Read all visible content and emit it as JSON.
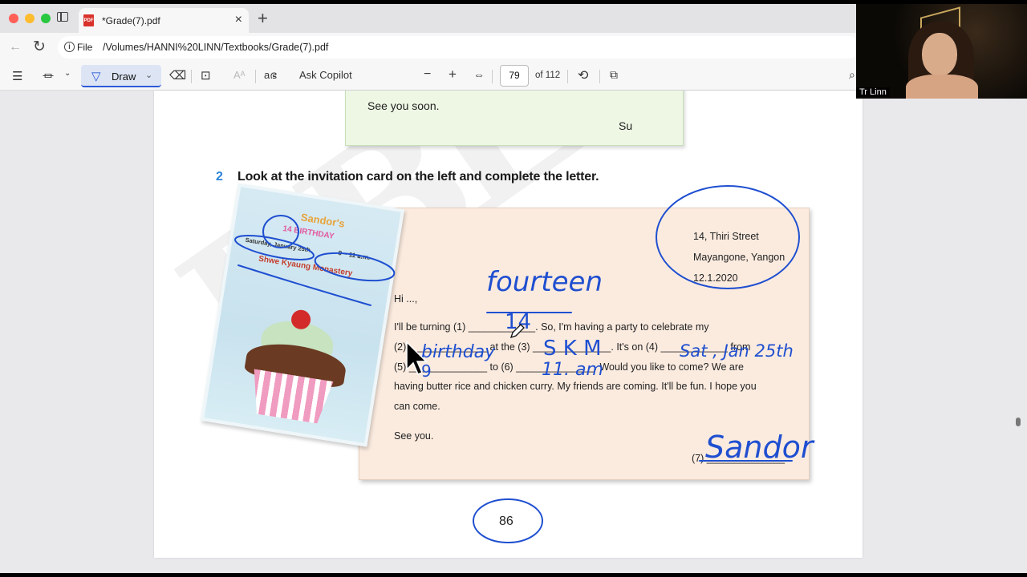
{
  "browser": {
    "tab_title": "*Grade(7).pdf",
    "tab_pdf_badge": "PDF",
    "url_scheme": "File",
    "url_path": "/Volumes/HANNI%20LINN/Textbooks/Grade(7).pdf"
  },
  "pdf_toolbar": {
    "draw_label": "Draw",
    "copilot_label": "Ask Copilot",
    "zoom_out": "−",
    "zoom_in": "+",
    "page_current": "79",
    "page_total": "of 112"
  },
  "document": {
    "prev_letter_closing": "See you soon.",
    "prev_letter_signature": "Su",
    "question_number": "2",
    "question_text": "Look at the invitation card on the left and complete the letter.",
    "card": {
      "name": "Sandor's",
      "birthday": "14 BIRTHDAY",
      "date": "Saturday, January 25th",
      "time": "9 – 11 a.m.",
      "venue": "Shwe Kyaung Monastery"
    },
    "letter": {
      "address_line1": "14, Thiri Street",
      "address_line2": "Mayangone, Yangon",
      "date": "12.1.2020",
      "greeting": "Hi ...,",
      "line1": "I'll  be  turning  (1) ____________.  So,  I'm  having  a  party  to  celebrate  my",
      "line2": "(2) ______________ at the (3) ______________. It's on (4) ____________ from",
      "line3": "(5) ______________ to (6) ______________. Would you like to come? We are",
      "line4": "having butter rice and chicken curry. My friends are coming. It'll be fun. I hope you",
      "line5": "can come.",
      "closing": "See you.",
      "signature_label": "(7) ______________"
    },
    "page_number": "86"
  },
  "annotations": {
    "fourteen": "fourteen",
    "ans1": "14",
    "ans2": "birthday",
    "ans3": "S K M",
    "ans4": "Sat , Jan 25th",
    "ans5": "9",
    "ans6": "11. am",
    "ans7": "Sandor",
    "ink_color": "#1f4fd0"
  },
  "webcam": {
    "name_label": "Tr Linn"
  }
}
